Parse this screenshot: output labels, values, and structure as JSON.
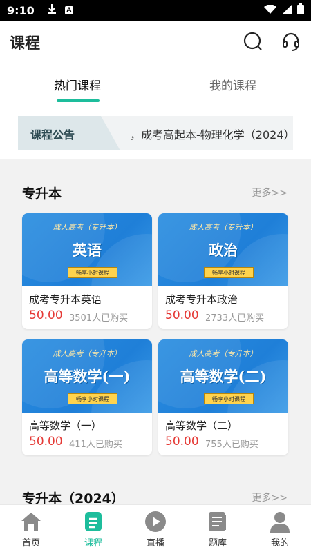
{
  "status_bar": {
    "time": "9:10",
    "badge": "A"
  },
  "app_bar": {
    "title": "课程",
    "search_icon": "search-icon",
    "support_icon": "headset-icon"
  },
  "tabs": [
    {
      "label": "热门课程",
      "active": true
    },
    {
      "label": "我的课程",
      "active": false
    }
  ],
  "notice": {
    "badge_label": "课程公告",
    "text": "，成考高起本-物理化学（2024）"
  },
  "sections": [
    {
      "title": "专升本",
      "more": "更多>>",
      "courses": [
        {
          "cover_sub": "成人高考（专升本）",
          "cover_name": "英语",
          "cover_btn": "畅享小时课程",
          "title": "成考专升本英语",
          "price": "50.00",
          "sold": "3501人已购买"
        },
        {
          "cover_sub": "成人高考（专升本）",
          "cover_name": "政治",
          "cover_btn": "畅享小时课程",
          "title": "成考专升本政治",
          "price": "50.00",
          "sold": "2733人已购买"
        },
        {
          "cover_sub": "成人高考（专升本）",
          "cover_name": "高等数学(一)",
          "cover_btn": "畅享小时课程",
          "title": "高等数学（一）",
          "price": "50.00",
          "sold": "411人已购买"
        },
        {
          "cover_sub": "成人高考（专升本）",
          "cover_name": "高等数学(二)",
          "cover_btn": "畅享小时课程",
          "title": "高等数学（二）",
          "price": "50.00",
          "sold": "755人已购买"
        }
      ]
    },
    {
      "title": "专升本（2024）",
      "more": "更多>>"
    }
  ],
  "bottom_nav": [
    {
      "label": "首页",
      "icon": "home-icon",
      "active": false
    },
    {
      "label": "课程",
      "icon": "course-icon",
      "active": true
    },
    {
      "label": "直播",
      "icon": "play-icon",
      "active": false
    },
    {
      "label": "题库",
      "icon": "question-bank-icon",
      "active": false
    },
    {
      "label": "我的",
      "icon": "profile-icon",
      "active": false
    }
  ],
  "colors": {
    "accent": "#1dbd9c",
    "price": "#e53935",
    "cover_blue": "#2a8de0"
  }
}
